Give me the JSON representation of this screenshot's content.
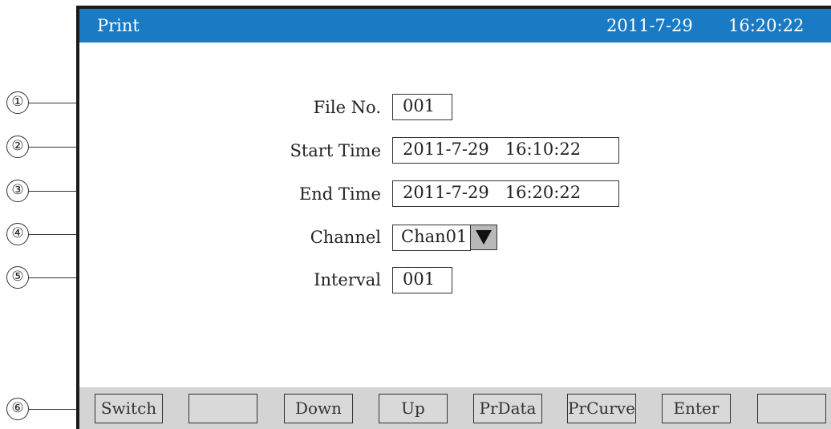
{
  "titlebar": {
    "title": "Print",
    "date": "2011-7-29",
    "time": "16:20:22",
    "bg_color": "#1a7bc4"
  },
  "callouts": [
    "①",
    "②",
    "③",
    "④",
    "⑤",
    "⑥"
  ],
  "form": {
    "file_no": {
      "label": "File No.",
      "value": "001"
    },
    "start_time": {
      "label": "Start Time",
      "value": "2011-7-29   16:10:22"
    },
    "end_time": {
      "label": "End Time",
      "value": "2011-7-29   16:20:22"
    },
    "channel": {
      "label": "Channel",
      "value": "Chan01",
      "dropdown_icon": "triangle-down-icon"
    },
    "interval": {
      "label": "Interval",
      "value": "001"
    }
  },
  "softkeys": [
    "Switch",
    "",
    "Down",
    "Up",
    "PrData",
    "PrCurve",
    "Enter",
    ""
  ]
}
